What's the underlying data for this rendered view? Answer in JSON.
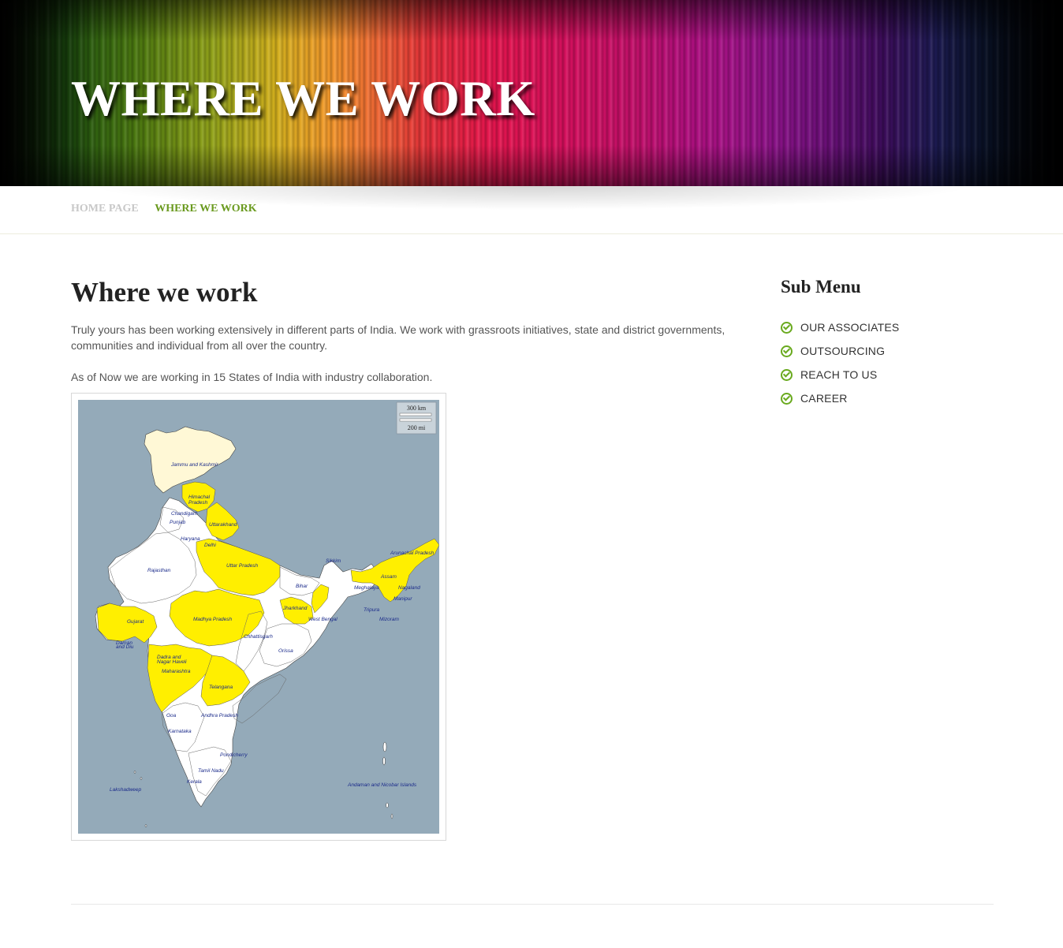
{
  "banner": {
    "title": "WHERE WE WORK"
  },
  "breadcrumb": {
    "home": "HOME PAGE",
    "current": "WHERE WE WORK"
  },
  "main": {
    "heading": "Where we work",
    "paragraph1": "Truly yours has been working extensively in different parts of India. We work with grassroots initiatives, state and district governments, communities and individual from all over the country.",
    "paragraph2": "As of Now we are working in 15 States of India with industry collaboration."
  },
  "map": {
    "scale_km": "300 km",
    "scale_mi": "200 mi",
    "colors": {
      "water": "#94aab9",
      "highlight": "#ffef00",
      "other": "#ffffff",
      "jk": "#fff8d6",
      "label": "#1a2a8a"
    },
    "labels": {
      "jammu_kashmir": "Jammu and Kashmir",
      "himachal_1": "Himachal",
      "himachal_2": "Pradesh",
      "chandigarh": "Chandigarh",
      "punjab": "Punjab",
      "uttarakhand": "Uttarakhand",
      "haryana": "Haryana",
      "delhi": "Delhi",
      "rajasthan": "Rajasthan",
      "uttar_pradesh": "Uttar Pradesh",
      "sikkim": "Sikkim",
      "arunachal": "Arunachal Pradesh",
      "assam": "Assam",
      "meghalaya": "Meghalaya",
      "nagaland": "Nagaland",
      "manipur": "Manipur",
      "bihar": "Bihar",
      "jharkhand": "Jharkhand",
      "west_bengal": "West Bengal",
      "tripura": "Tripura",
      "mizoram": "Mizoram",
      "gujarat": "Gujarat",
      "madhya_pradesh": "Madhya Pradesh",
      "chhattisgarh": "Chhattisgarh",
      "orissa": "Orissa",
      "daman_1": "Daman",
      "daman_2": "and Diu",
      "dadra_1": "Dadra and",
      "dadra_2": "Nagar Haveli",
      "maharashtra": "Maharashtra",
      "telangana": "Telangana",
      "goa": "Goa",
      "andhra": "Andhra Pradesh",
      "karnataka": "Karnataka",
      "pondicherry": "Pondicherry",
      "tamil_nadu": "Tamil Nadu",
      "kerala": "Kerala",
      "lakshadweep": "Lakshadweep",
      "andaman": "Andaman and Nicobar Islands"
    }
  },
  "sidebar": {
    "title": "Sub Menu",
    "items": [
      {
        "label": "OUR ASSOCIATES"
      },
      {
        "label": "OUTSOURCING"
      },
      {
        "label": "REACH TO US"
      },
      {
        "label": "CAREER"
      }
    ]
  }
}
